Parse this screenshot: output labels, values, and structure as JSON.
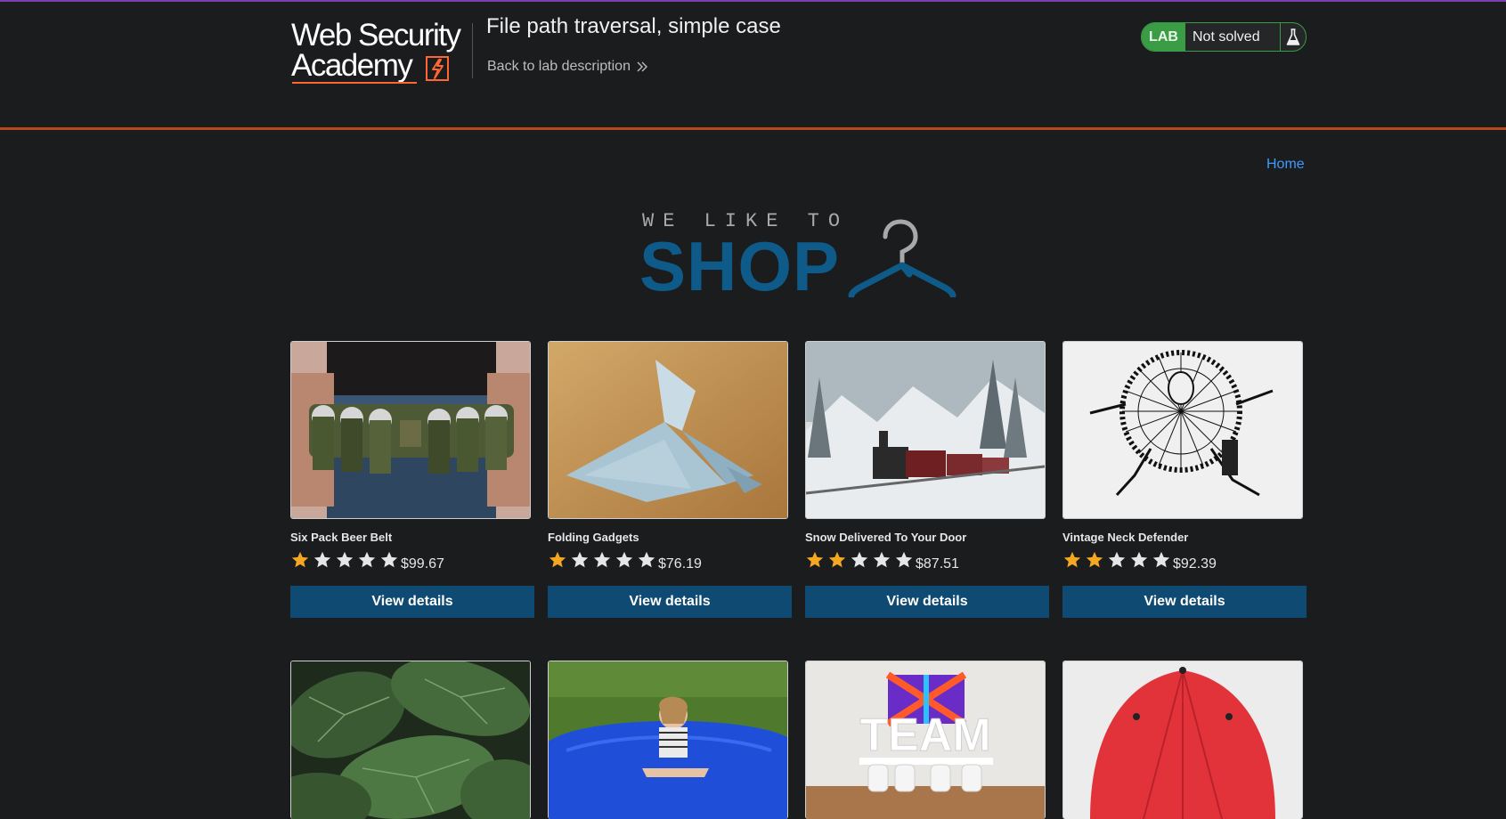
{
  "header": {
    "logo_line1": "Web Security",
    "logo_line2": "Academy",
    "lab_title": "File path traversal, simple case",
    "back_link": "Back to lab description",
    "badge": {
      "label": "LAB",
      "status": "Not solved"
    }
  },
  "nav": {
    "home": "Home"
  },
  "banner": {
    "small_text": "WE LIKE TO",
    "big_text": "SHOP"
  },
  "products": [
    {
      "name": "Six Pack Beer Belt",
      "rating": 1,
      "price": "$99.67",
      "button": "View details",
      "image": "beer-belt"
    },
    {
      "name": "Folding Gadgets",
      "rating": 1,
      "price": "$76.19",
      "button": "View details",
      "image": "origami"
    },
    {
      "name": "Snow Delivered To Your Door",
      "rating": 2,
      "price": "$87.51",
      "button": "View details",
      "image": "snow-train"
    },
    {
      "name": "Vintage Neck Defender",
      "rating": 2,
      "price": "$92.39",
      "button": "View details",
      "image": "neck-defender"
    },
    {
      "image": "leaves"
    },
    {
      "image": "bean-bag"
    },
    {
      "image": "team"
    },
    {
      "image": "umbrella"
    }
  ],
  "colors": {
    "background": "#1b1c1e",
    "accent_rule": "#b8491a",
    "lab_green": "#3b9c46",
    "button": "#0f4a73",
    "shop_blue": "#0e5b8a",
    "star_filled": "#f5a623",
    "star_empty": "#e6e6e6",
    "link": "#3d9bff"
  }
}
